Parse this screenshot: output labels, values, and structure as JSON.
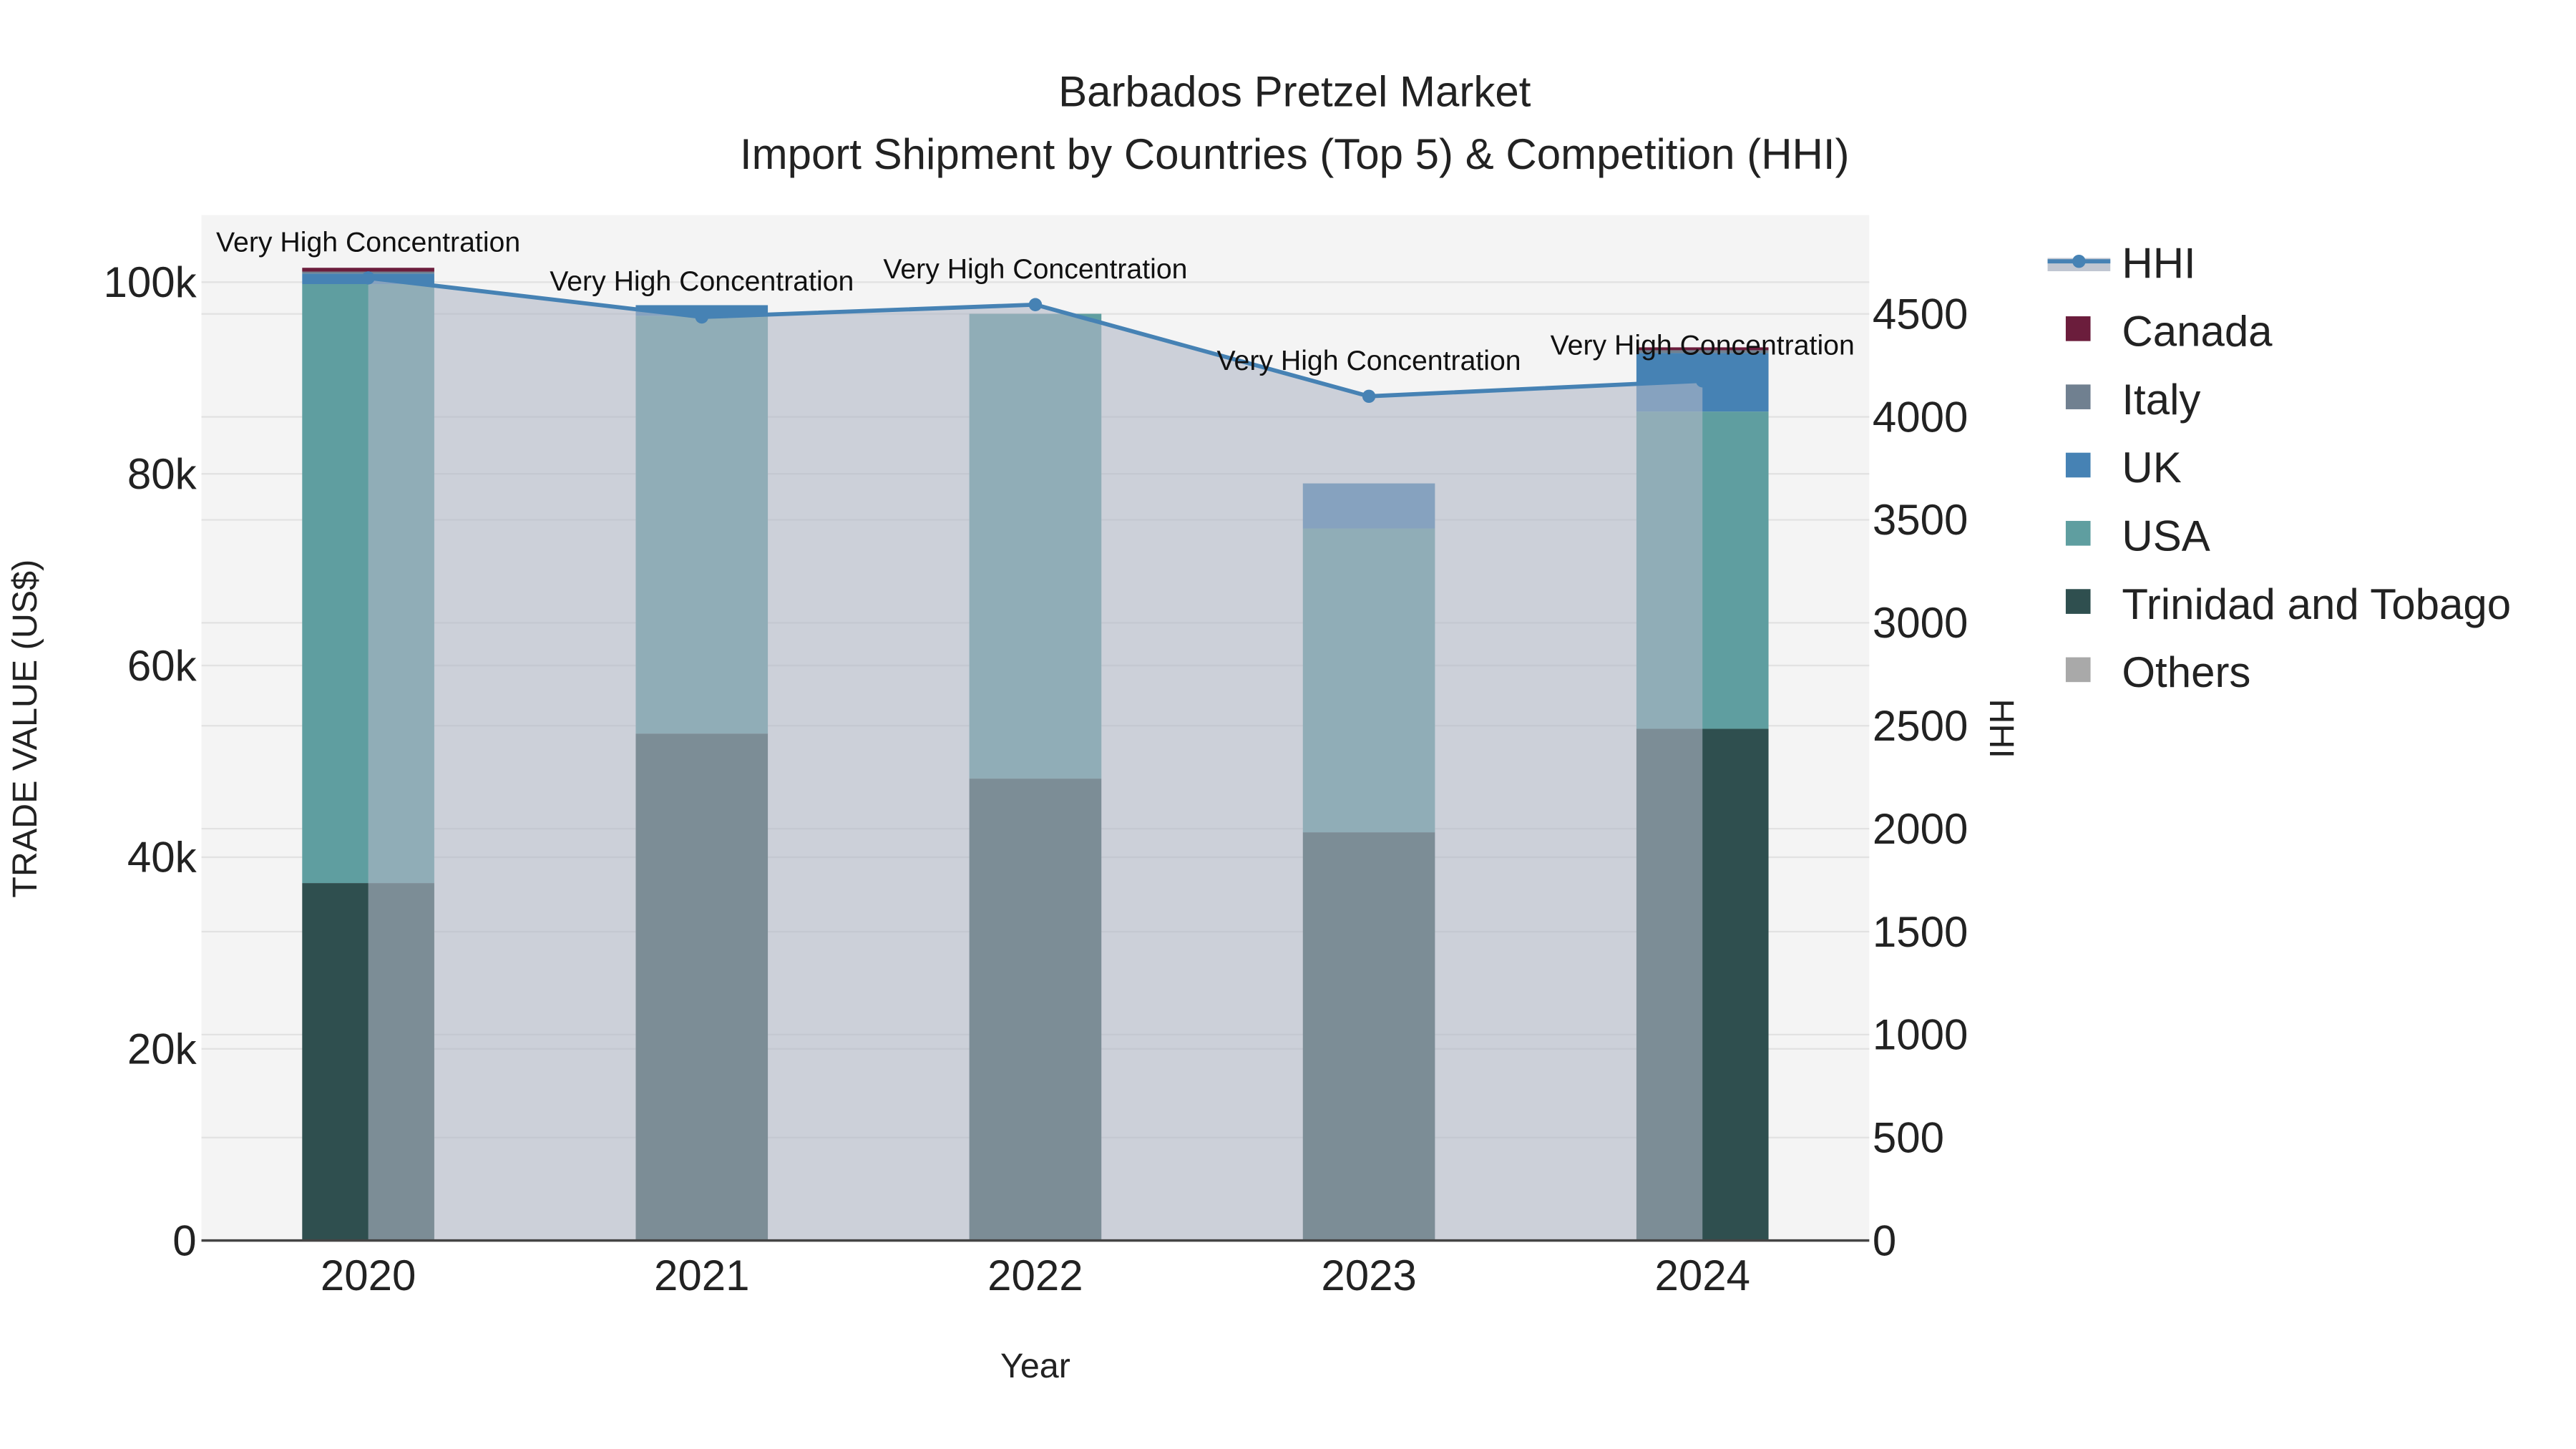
{
  "chart_data": {
    "type": "bar",
    "title_line1": "Barbados Pretzel Market",
    "title_line2": "Import Shipment by Countries (Top 5) & Competition (HHI)",
    "xlabel": "Year",
    "ylabel": "TRADE VALUE (US$)",
    "y2label": "HHI",
    "categories": [
      "2020",
      "2021",
      "2022",
      "2023",
      "2024"
    ],
    "ylim": [
      0,
      107000
    ],
    "y2lim": [
      0,
      4980
    ],
    "yticks": [
      0,
      20000,
      40000,
      60000,
      80000,
      100000
    ],
    "ytick_labels": [
      "0",
      "20k",
      "40k",
      "60k",
      "80k",
      "100k"
    ],
    "y2ticks": [
      0,
      500,
      1000,
      1500,
      2000,
      2500,
      3000,
      3500,
      4000,
      4500
    ],
    "y2tick_labels": [
      "0",
      "500",
      "1000",
      "1500",
      "2000",
      "2500",
      "3000",
      "3500",
      "4000",
      "4500"
    ],
    "grid": true,
    "legend_position": "right",
    "series": [
      {
        "name": "Trinidad and Tobago",
        "color": "#2f4f4f",
        "values": [
          37300,
          52900,
          48200,
          42600,
          53400
        ]
      },
      {
        "name": "USA",
        "color": "#5f9ea0",
        "values": [
          62500,
          43600,
          48500,
          31700,
          33100
        ]
      },
      {
        "name": "UK",
        "color": "#4682b4",
        "values": [
          1100,
          1100,
          0,
          4700,
          6100
        ]
      },
      {
        "name": "Italy",
        "color": "#708090",
        "values": [
          200,
          0,
          0,
          0,
          300
        ]
      },
      {
        "name": "Canada",
        "color": "#6b1d3c",
        "values": [
          400,
          0,
          0,
          0,
          300
        ]
      },
      {
        "name": "Others",
        "color": "#a9a9a9",
        "values": [
          0,
          0,
          0,
          0,
          0
        ]
      }
    ],
    "hhi": {
      "name": "HHI",
      "color": "#4682b4",
      "values": [
        4675,
        4485,
        4545,
        4100,
        4175
      ]
    },
    "annotations": [
      "Very High Concentration",
      "Very High Concentration",
      "Very High Concentration",
      "Very High Concentration",
      "Very High Concentration"
    ],
    "legend": [
      "HHI",
      "Canada",
      "Italy",
      "UK",
      "USA",
      "Trinidad and Tobago",
      "Others"
    ]
  }
}
